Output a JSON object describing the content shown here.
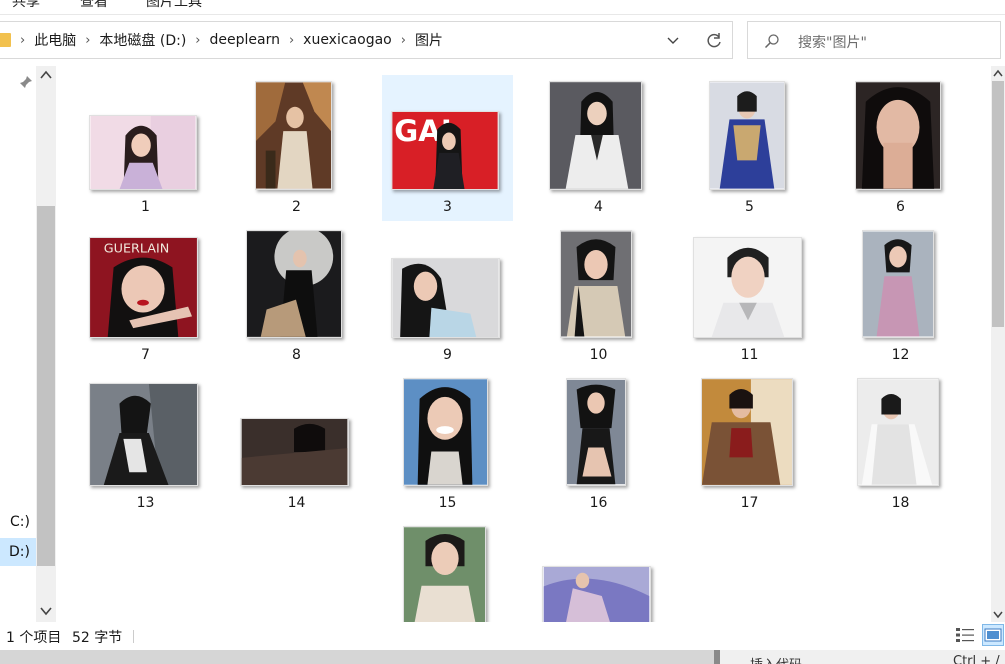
{
  "ribbon": {
    "tabs": [
      "共享",
      "查看",
      "图片工具"
    ]
  },
  "address": {
    "crumbs": [
      "此电脑",
      "本地磁盘 (D:)",
      "deeplearn",
      "xuexicaogao",
      "图片"
    ]
  },
  "search": {
    "placeholder": "搜索\"图片\""
  },
  "nav": {
    "drives": [
      {
        "label": "C:)"
      },
      {
        "label": "D:)"
      }
    ]
  },
  "items": [
    {
      "label": "1"
    },
    {
      "label": "2"
    },
    {
      "label": "3"
    },
    {
      "label": "4"
    },
    {
      "label": "5"
    },
    {
      "label": "6"
    },
    {
      "label": "7"
    },
    {
      "label": "8"
    },
    {
      "label": "9"
    },
    {
      "label": "10"
    },
    {
      "label": "11"
    },
    {
      "label": "12"
    },
    {
      "label": "13"
    },
    {
      "label": "14"
    },
    {
      "label": "15"
    },
    {
      "label": "16"
    },
    {
      "label": "17"
    },
    {
      "label": "18"
    },
    {
      "label": ""
    },
    {
      "label": ""
    }
  ],
  "thumbs": {
    "3": {
      "text": "GAI"
    },
    "7": {
      "text": "GUERLAIN"
    }
  },
  "status": {
    "count": "1 个项目",
    "size": "52 字节"
  },
  "taskbar": {
    "left": "插入代码",
    "mid": "Ctrl + /"
  },
  "colors": {
    "selection": "#e5f3ff",
    "accent": "#cce8ff",
    "folder": "#f2c14e"
  }
}
